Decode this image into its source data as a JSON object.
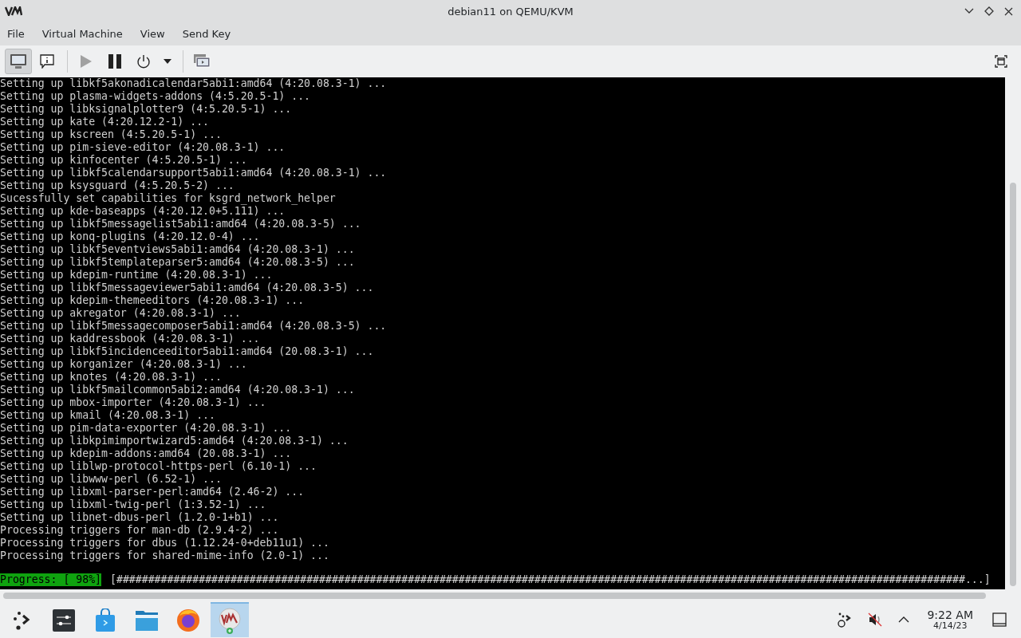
{
  "window": {
    "title": "debian11 on QEMU/KVM"
  },
  "menu": [
    "File",
    "Virtual Machine",
    "View",
    "Send Key"
  ],
  "toolbar": [
    {
      "kind": "console",
      "selected": true,
      "disabled": false
    },
    {
      "kind": "details",
      "selected": false,
      "disabled": false
    },
    {
      "kind": "run",
      "selected": false,
      "disabled": true
    },
    {
      "kind": "pause",
      "selected": false,
      "disabled": false
    },
    {
      "kind": "power",
      "selected": false,
      "disabled": false
    },
    {
      "kind": "dropdown",
      "selected": false,
      "disabled": false
    },
    {
      "kind": "snapshots",
      "selected": false,
      "disabled": false
    }
  ],
  "terminal": {
    "lines": [
      "Setting up libkf5akonadicalendar5abi1:amd64 (4:20.08.3-1) ...",
      "Setting up plasma-widgets-addons (4:5.20.5-1) ...",
      "Setting up libksignalplotter9 (4:5.20.5-1) ...",
      "Setting up kate (4:20.12.2-1) ...",
      "Setting up kscreen (4:5.20.5-1) ...",
      "Setting up pim-sieve-editor (4:20.08.3-1) ...",
      "Setting up kinfocenter (4:5.20.5-1) ...",
      "Setting up libkf5calendarsupport5abi1:amd64 (4:20.08.3-1) ...",
      "Setting up ksysguard (4:5.20.5-2) ...",
      "Sucessfully set capabilities for ksgrd_network_helper",
      "Setting up kde-baseapps (4:20.12.0+5.111) ...",
      "Setting up libkf5messagelist5abi1:amd64 (4:20.08.3-5) ...",
      "Setting up konq-plugins (4:20.12.0-4) ...",
      "Setting up libkf5eventviews5abi1:amd64 (4:20.08.3-1) ...",
      "Setting up libkf5templateparser5:amd64 (4:20.08.3-5) ...",
      "Setting up kdepim-runtime (4:20.08.3-1) ...",
      "Setting up libkf5messageviewer5abi1:amd64 (4:20.08.3-5) ...",
      "Setting up kdepim-themeeditors (4:20.08.3-1) ...",
      "Setting up akregator (4:20.08.3-1) ...",
      "Setting up libkf5messagecomposer5abi1:amd64 (4:20.08.3-5) ...",
      "Setting up kaddressbook (4:20.08.3-1) ...",
      "Setting up libkf5incidenceeditor5abi1:amd64 (20.08.3-1) ...",
      "Setting up korganizer (4:20.08.3-1) ...",
      "Setting up knotes (4:20.08.3-1) ...",
      "Setting up libkf5mailcommon5abi2:amd64 (4:20.08.3-1) ...",
      "Setting up mbox-importer (4:20.08.3-1) ...",
      "Setting up kmail (4:20.08.3-1) ...",
      "Setting up pim-data-exporter (4:20.08.3-1) ...",
      "Setting up libkpimimportwizard5:amd64 (4:20.08.3-1) ...",
      "Setting up kdepim-addons:amd64 (20.08.3-1) ...",
      "Setting up liblwp-protocol-https-perl (6.10-1) ...",
      "Setting up libwww-perl (6.52-1) ...",
      "Setting up libxml-parser-perl:amd64 (2.46-2) ...",
      "Setting up libxml-twig-perl (1:3.52-1) ...",
      "Setting up libnet-dbus-perl (1.2.0-1+b1) ...",
      "Processing triggers for man-db (2.9.4-2) ...",
      "Processing triggers for dbus (1.12.24-0+deb11u1) ...",
      "Processing triggers for shared-mime-info (2.0-1) ..."
    ],
    "progress_label": "Progress: [ 98%]",
    "progress_bar": "[######################################################################################################################################...]"
  },
  "taskbar": {
    "apps": [
      {
        "kind": "launcher",
        "selected": false
      },
      {
        "kind": "settings",
        "selected": false
      },
      {
        "kind": "store",
        "selected": false
      },
      {
        "kind": "files",
        "selected": false
      },
      {
        "kind": "browser",
        "selected": false
      },
      {
        "kind": "virt-manager",
        "selected": true
      }
    ],
    "time": "9:22 AM",
    "date": "4/14/23"
  }
}
